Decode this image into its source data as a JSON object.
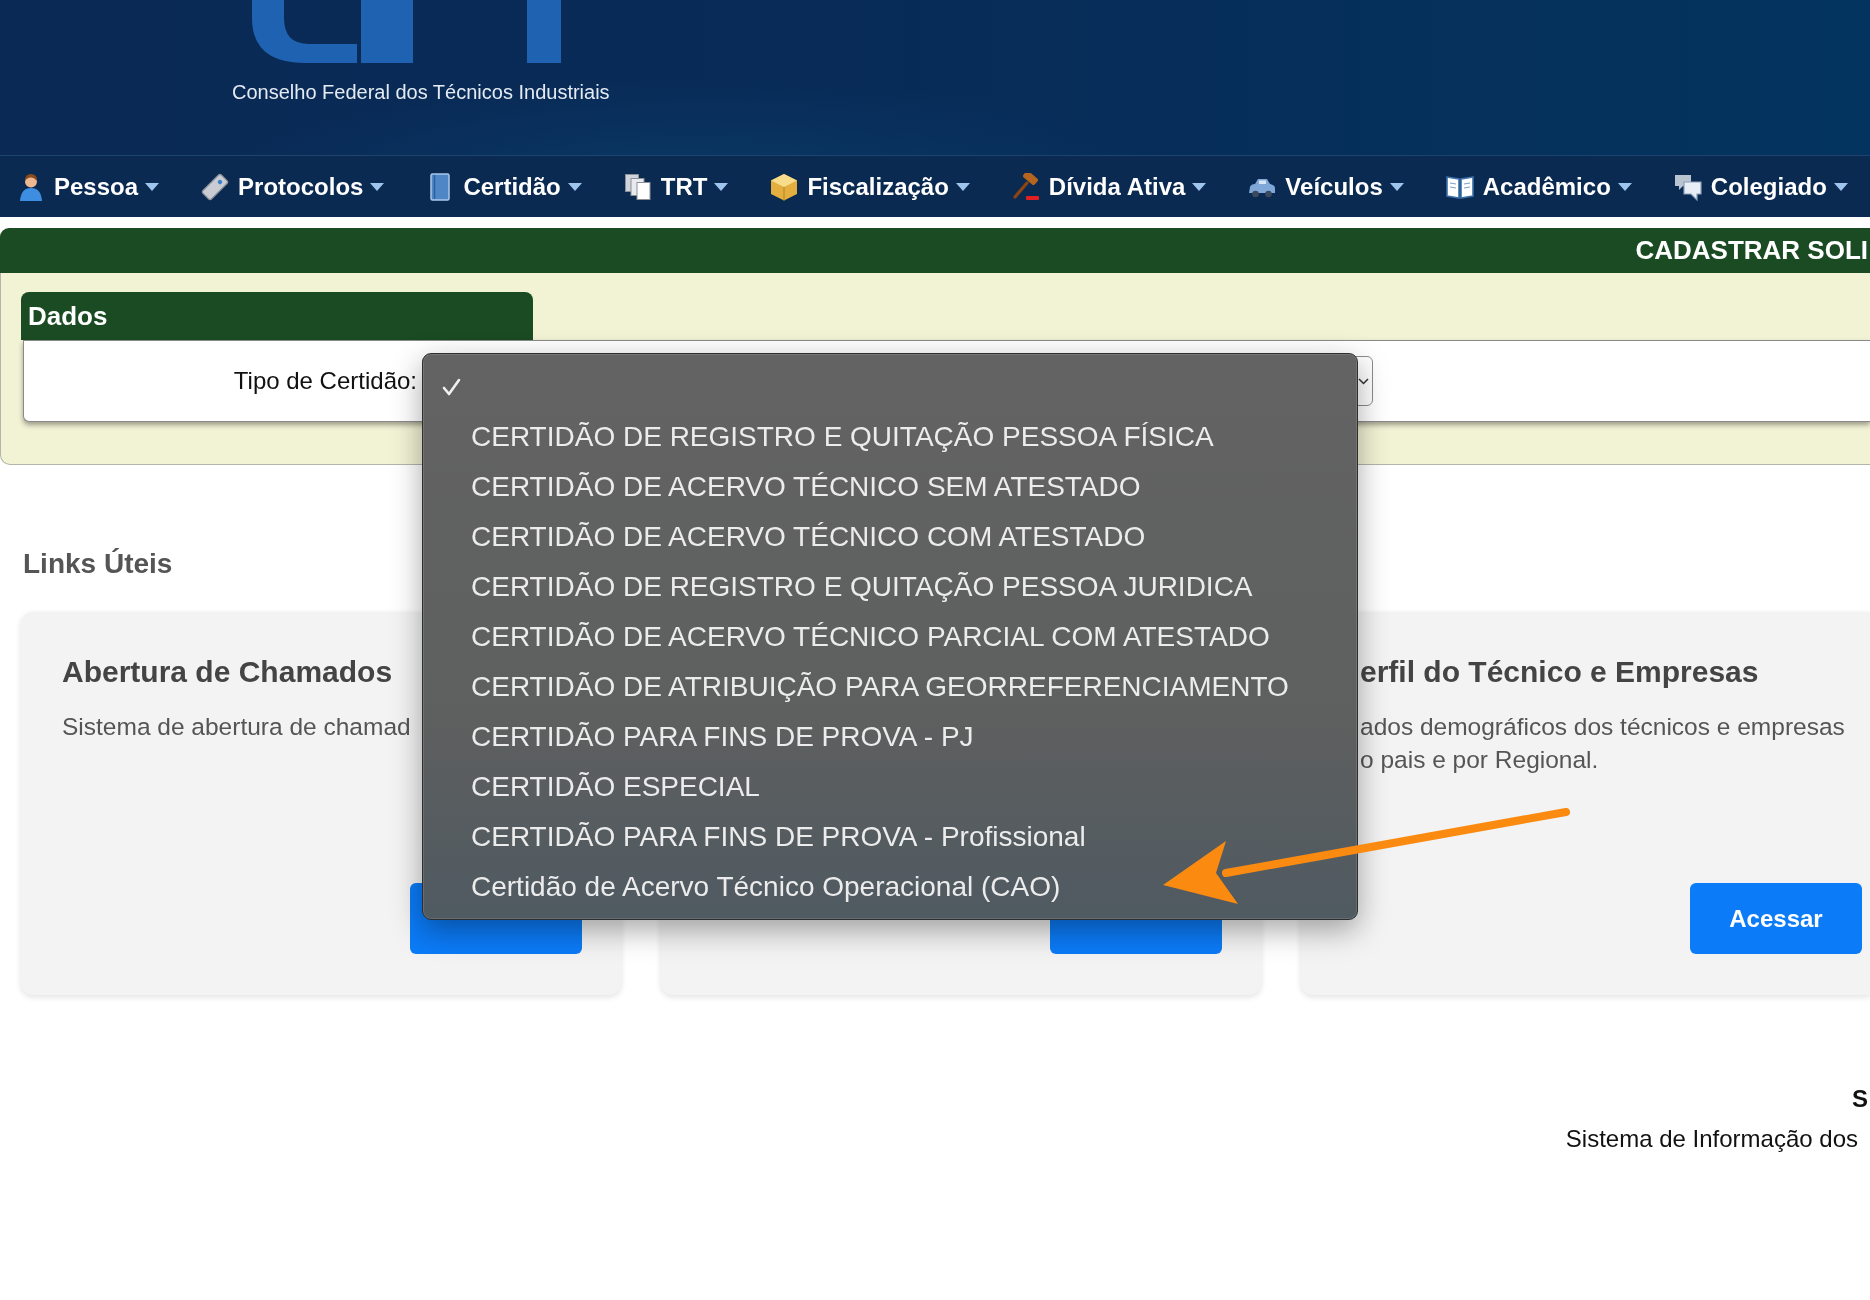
{
  "header": {
    "subtitle": "Conselho Federal dos Técnicos Industriais"
  },
  "nav": [
    {
      "label": "Pessoa"
    },
    {
      "label": "Protocolos"
    },
    {
      "label": "Certidão"
    },
    {
      "label": "TRT"
    },
    {
      "label": "Fiscalização"
    },
    {
      "label": "Dívida Ativa"
    },
    {
      "label": "Veículos"
    },
    {
      "label": "Acadêmico"
    },
    {
      "label": "Colegiado"
    }
  ],
  "form": {
    "title": "CADASTRAR SOLI",
    "section": "Dados",
    "field": {
      "label": "Tipo de Certidão:",
      "open": true,
      "options": [
        {
          "selected": true
        },
        {
          "label": "CERTIDÃO DE REGISTRO E QUITAÇÃO PESSOA FÍSICA",
          "selected": false
        },
        {
          "label": "CERTIDÃO DE ACERVO TÉCNICO SEM ATESTADO",
          "selected": false
        },
        {
          "label": "CERTIDÃO DE ACERVO TÉCNICO COM ATESTADO",
          "selected": false
        },
        {
          "label": "CERTIDÃO DE REGISTRO E QUITAÇÃO PESSOA JURIDICA",
          "selected": false
        },
        {
          "label": "CERTIDÃO DE ACERVO TÉCNICO PARCIAL COM ATESTADO",
          "selected": false
        },
        {
          "label": "CERTIDÃO DE ATRIBUIÇÃO PARA GEORREFERENCIAMENTO",
          "selected": false
        },
        {
          "label": "CERTIDÃO PARA FINS DE PROVA - PJ",
          "selected": false
        },
        {
          "label": "CERTIDÃO ESPECIAL",
          "selected": false
        },
        {
          "label": "CERTIDÃO PARA FINS DE PROVA - Profissional",
          "selected": false
        },
        {
          "label": "Certidão de Acervo Técnico Operacional (CAO)",
          "selected": false
        }
      ]
    }
  },
  "links": {
    "title": "Links Úteis",
    "cards": [
      {
        "title": "Abertura de Chamados",
        "description": [
          "Sistema de abertura de chamad"
        ],
        "button": {
          "kind": "primary"
        }
      },
      {
        "button": {
          "kind": "primary"
        }
      },
      {
        "title": "erfil do Técnico e Empresas",
        "description": [
          "ados demográficos dos técnicos e empresas",
          "o pais e por Regional."
        ],
        "button": {
          "kind": "primary",
          "label": "Acessar"
        }
      }
    ]
  },
  "footer": {
    "title": "S",
    "text": "Sistema de Informação dos"
  }
}
